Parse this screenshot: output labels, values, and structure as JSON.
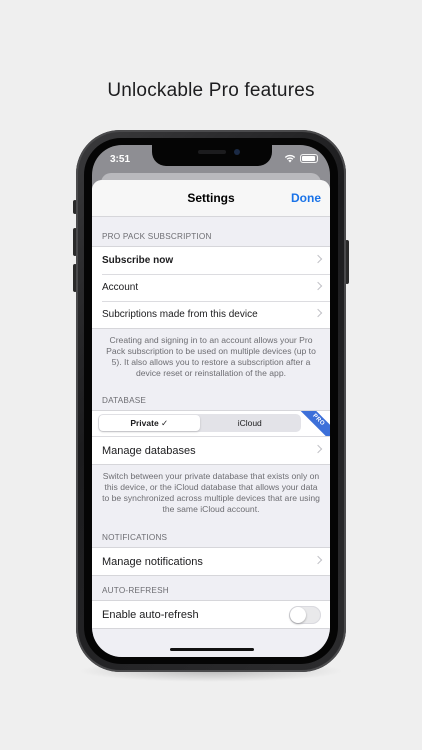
{
  "headline": "Unlockable Pro features",
  "status_bar": {
    "time": "3:51",
    "wifi_icon": "wifi-icon",
    "battery_icon": "battery-icon"
  },
  "nav": {
    "title": "Settings",
    "done_label": "Done"
  },
  "pro_pack": {
    "header": "PRO PACK SUBSCRIPTION",
    "items": [
      {
        "label": "Subscribe now"
      },
      {
        "label": "Account"
      },
      {
        "label": "Subcriptions made from this device"
      }
    ],
    "footer": "Creating and signing in to an account allows your Pro Pack subscription to be used on multiple devices (up to 5). It also allows you to restore a subscription after a device reset or reinstallation of the app."
  },
  "database": {
    "header": "DATABASE",
    "segments": [
      "Private ✓",
      "iCloud"
    ],
    "selected_segment": "Private ✓",
    "ribbon": "PRO",
    "manage_label": "Manage databases",
    "footer": "Switch between your private database that exists only on this device, or the iCloud database that allows your data to be synchronized across multiple devices that are using the same iCloud account."
  },
  "notifications": {
    "header": "NOTIFICATIONS",
    "manage_label": "Manage notifications"
  },
  "auto_refresh": {
    "header": "AUTO-REFRESH",
    "toggle_label": "Enable auto-refresh",
    "enabled": false
  },
  "colors": {
    "accent": "#1a73e8",
    "ribbon": "#3d70d9",
    "background": "#efefef"
  }
}
